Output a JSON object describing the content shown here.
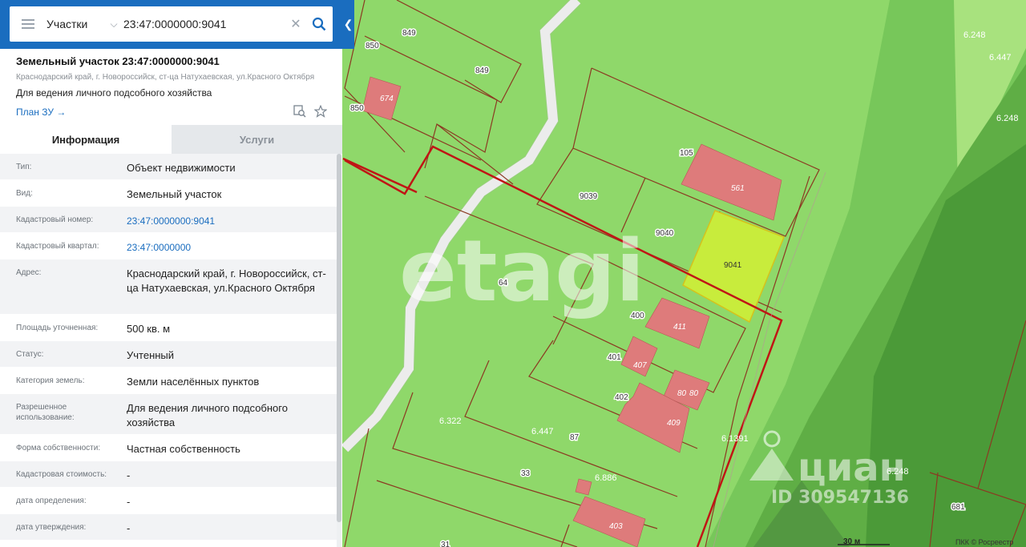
{
  "search": {
    "category": "Участки",
    "value": "23:47:0000000:9041"
  },
  "parcel": {
    "title": "Земельный участок 23:47:0000000:9041",
    "address": "Краснодарский край, г. Новороссийск, ст-ца Натухаевская, ул.Красного Октября",
    "purpose": "Для ведения личного подсобного хозяйства",
    "plan_link": "План ЗУ →"
  },
  "tabs": [
    {
      "label": "Информация",
      "active": true
    },
    {
      "label": "Услуги",
      "active": false
    }
  ],
  "info_rows": [
    {
      "label": "Тип:",
      "value": "Объект недвижимости"
    },
    {
      "label": "Вид:",
      "value": "Земельный участок"
    },
    {
      "label": "Кадастровый номер:",
      "value": "23:47:0000000:9041",
      "link": true
    },
    {
      "label": "Кадастровый квартал:",
      "value": "23:47:0000000",
      "link": true
    },
    {
      "label": "Адрес:",
      "value": "Краснодарский край, г. Новороссийск, ст-ца Натухаевская, ул.Красного Октября"
    },
    {
      "label": "Площадь уточненная:",
      "value": "500 кв. м"
    },
    {
      "label": "Статус:",
      "value": "Учтенный"
    },
    {
      "label": "Категория земель:",
      "value": "Земли населённых пунктов"
    },
    {
      "label": "Разрешенное использование:",
      "value": "Для ведения личного подсобного хозяйства"
    },
    {
      "label": "Форма собственности:",
      "value": "Частная собственность"
    },
    {
      "label": "Кадастровая стоимость:",
      "value": "-"
    },
    {
      "label": "дата определения:",
      "value": "-"
    },
    {
      "label": "дата утверждения:",
      "value": "-"
    }
  ],
  "map": {
    "plot_labels": [
      "849",
      "850",
      "849",
      "850",
      "674",
      "105",
      "561",
      "9039",
      "9040",
      "9041",
      "64",
      "400",
      "411",
      "401",
      "407",
      "402",
      "80",
      "80",
      "409",
      "6.322",
      "6.447",
      "87",
      "33",
      "6.886",
      "403",
      "31",
      "6.248",
      "6.447",
      "6.248",
      "6.1391",
      "6.248",
      "681"
    ],
    "watermark_etagi": "etagi",
    "watermark_cian": "циан",
    "watermark_id": "ID 309547136",
    "scale": "30 м",
    "attribution": "ПКК © Росреестр"
  },
  "colors": {
    "header_blue": "#1a6dbf",
    "land_green": "#8fd86a",
    "highlight_yellow": "#c8ec3c",
    "building_pink": "#de7b7b",
    "boundary_red": "#c01515"
  }
}
